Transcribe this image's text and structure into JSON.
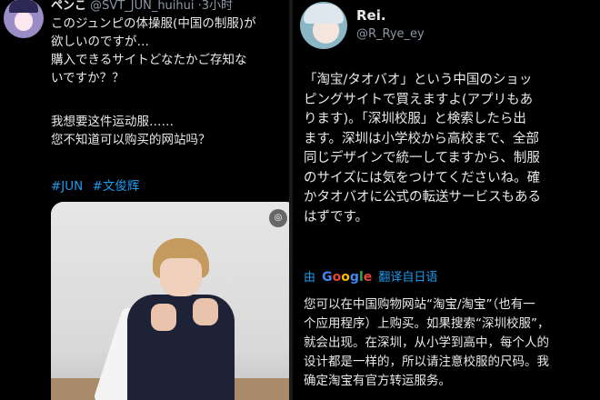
{
  "left_tweet": {
    "display_name": "ペンこ",
    "handle": "@SVT_JUN_huihui",
    "time": "·3小时",
    "jp_lines": [
      "このジュンピの体操服(中国の制服)が",
      "欲しいのですが…",
      "購入できるサイトどなたかご存知な",
      "いですか？？"
    ],
    "cn_lines": [
      "我想要这件运动服……",
      "您不知道可以购买的网站吗？"
    ],
    "hashtags": [
      "#JUN",
      "#文俊辉"
    ],
    "media_icon": "◎"
  },
  "right_tweet": {
    "display_name": "Rei.",
    "handle": "@R_Rye_ey",
    "body_lines": [
      "「淘宝/タオバオ」という中国のショッ",
      "ピングサイトで買えますよ(アプリもあ",
      "ります)。「深圳校服」と検索したら出",
      "ます。深圳は小学校から高校まで、全部",
      "同じデザインで統一してますから、制服",
      "のサイズには気をつけてくださいね。確",
      "かタオバオに公式の転送サービスもある",
      "はずです。"
    ],
    "translate": {
      "by": "由",
      "google": [
        "G",
        "o",
        "o",
        "g",
        "l",
        "e"
      ],
      "action": "翻译自日语"
    },
    "translation_lines": [
      "您可以在中国购物网站“淘宝/淘宝”（也有一",
      "个应用程序）上购买。如果搜索“深圳校服”，",
      "就会出现。在深圳，从小学到高中，每个人的",
      "设计都是一样的，所以请注意校服的尺码。我",
      "确定淘宝有官方转运服务。"
    ]
  },
  "colors": {
    "background": "#000000",
    "text": "#e7e9ea",
    "secondary": "#8b98a5",
    "link": "#1d9bf0"
  }
}
